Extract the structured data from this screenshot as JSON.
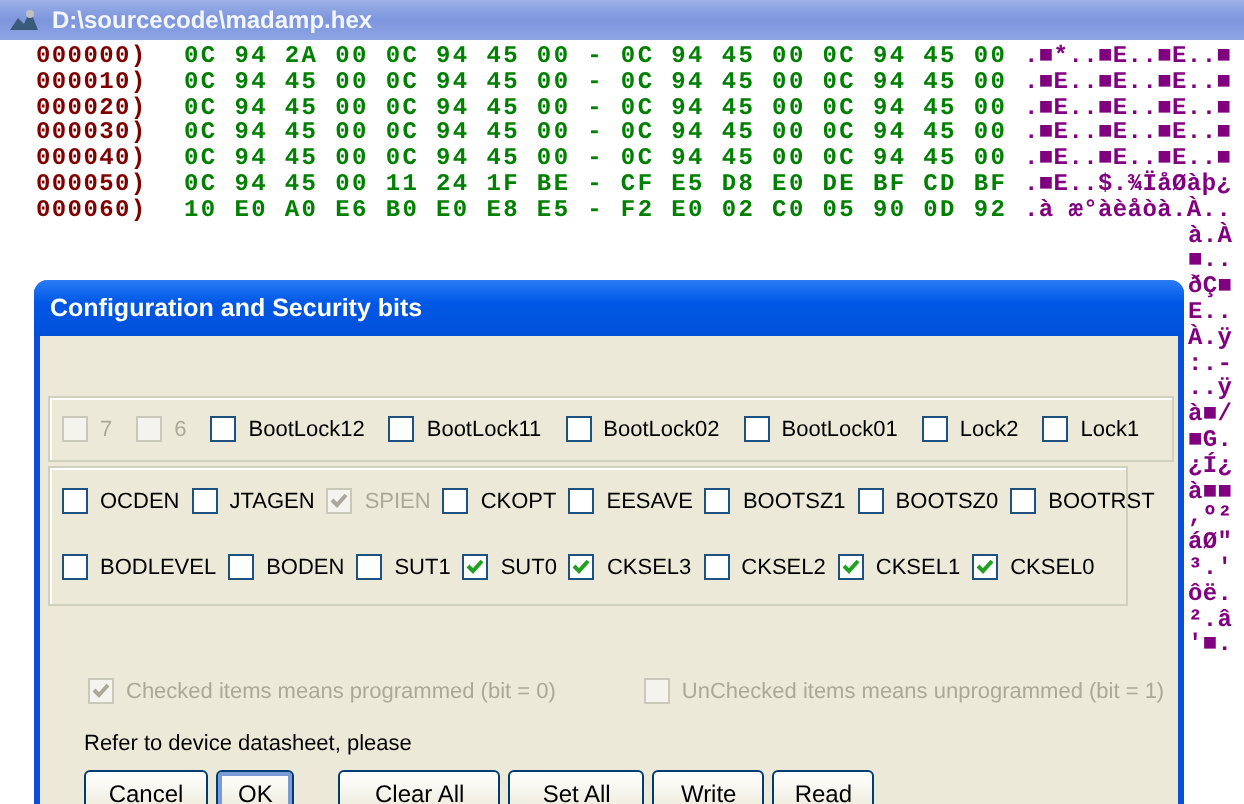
{
  "window": {
    "title": "D:\\sourcecode\\madamp.hex"
  },
  "hex_rows": [
    {
      "address": "000000)",
      "bytes": "0C 94 2A 00 0C 94 45 00 - 0C 94 45 00 0C 94 45 00",
      "ascii": ".■*..■E..■E..■"
    },
    {
      "address": "000010)",
      "bytes": "0C 94 45 00 0C 94 45 00 - 0C 94 45 00 0C 94 45 00",
      "ascii": ".■E..■E..■E..■"
    },
    {
      "address": "000020)",
      "bytes": "0C 94 45 00 0C 94 45 00 - 0C 94 45 00 0C 94 45 00",
      "ascii": ".■E..■E..■E..■"
    },
    {
      "address": "000030)",
      "bytes": "0C 94 45 00 0C 94 45 00 - 0C 94 45 00 0C 94 45 00",
      "ascii": ".■E..■E..■E..■"
    },
    {
      "address": "000040)",
      "bytes": "0C 94 45 00 0C 94 45 00 - 0C 94 45 00 0C 94 45 00",
      "ascii": ".■E..■E..■E..■"
    },
    {
      "address": "000050)",
      "bytes": "0C 94 45 00 11 24 1F BE - CF E5 D8 E0 DE BF CD BF",
      "ascii": ".■E..$.¾ÏåØàþ¿"
    },
    {
      "address": "000060)",
      "bytes": "10 E0 A0 E6 B0 E0 E8 E5 - F2 E0 02 C0 05 90 0D 92",
      "ascii": ".à æ°àèåòà.À.."
    }
  ],
  "ascii_fragments": [
    "à.À",
    "■..",
    "ðÇ■",
    "E..",
    "À.ÿ",
    ":.-",
    "..ÿ",
    "à■/",
    "■G.",
    "¿Í¿",
    "à■■",
    ",º²",
    "áØ\"",
    "³.'",
    "ôë.",
    "².â",
    "'■."
  ],
  "dialog": {
    "title": "Configuration and Security bits",
    "lock_bits": [
      {
        "label": "7",
        "checked": false,
        "disabled": true
      },
      {
        "label": "6",
        "checked": false,
        "disabled": true
      },
      {
        "label": "BootLock12",
        "checked": false,
        "disabled": false
      },
      {
        "label": "BootLock11",
        "checked": false,
        "disabled": false
      },
      {
        "label": "BootLock02",
        "checked": false,
        "disabled": false
      },
      {
        "label": "BootLock01",
        "checked": false,
        "disabled": false
      },
      {
        "label": "Lock2",
        "checked": false,
        "disabled": false
      },
      {
        "label": "Lock1",
        "checked": false,
        "disabled": false
      }
    ],
    "fuse_rows": [
      [
        {
          "label": "OCDEN",
          "checked": false,
          "disabled": false
        },
        {
          "label": "JTAGEN",
          "checked": false,
          "disabled": false
        },
        {
          "label": "SPIEN",
          "checked": true,
          "disabled": true
        },
        {
          "label": "CKOPT",
          "checked": false,
          "disabled": false
        },
        {
          "label": "EESAVE",
          "checked": false,
          "disabled": false
        },
        {
          "label": "BOOTSZ1",
          "checked": false,
          "disabled": false
        },
        {
          "label": "BOOTSZ0",
          "checked": false,
          "disabled": false
        },
        {
          "label": "BOOTRST",
          "checked": false,
          "disabled": false
        }
      ],
      [
        {
          "label": "BODLEVEL",
          "checked": false,
          "disabled": false
        },
        {
          "label": "BODEN",
          "checked": false,
          "disabled": false
        },
        {
          "label": "SUT1",
          "checked": false,
          "disabled": false
        },
        {
          "label": "SUT0",
          "checked": true,
          "disabled": false
        },
        {
          "label": "CKSEL3",
          "checked": true,
          "disabled": false
        },
        {
          "label": "CKSEL2",
          "checked": false,
          "disabled": false
        },
        {
          "label": "CKSEL1",
          "checked": true,
          "disabled": false
        },
        {
          "label": "CKSEL0",
          "checked": true,
          "disabled": false
        }
      ]
    ],
    "legend": [
      {
        "label": "Checked items means programmed (bit = 0)",
        "checked": true,
        "disabled": true
      },
      {
        "label": "UnChecked items means unprogrammed (bit = 1)",
        "checked": false,
        "disabled": true
      }
    ],
    "note": "Refer to device datasheet, please",
    "buttons": [
      {
        "label": "Cancel",
        "default": false
      },
      {
        "label": "OK",
        "default": true
      },
      {
        "label": "Clear All",
        "default": false
      },
      {
        "label": "Set All",
        "default": false
      },
      {
        "label": "Write",
        "default": false
      },
      {
        "label": "Read",
        "default": false
      }
    ]
  }
}
